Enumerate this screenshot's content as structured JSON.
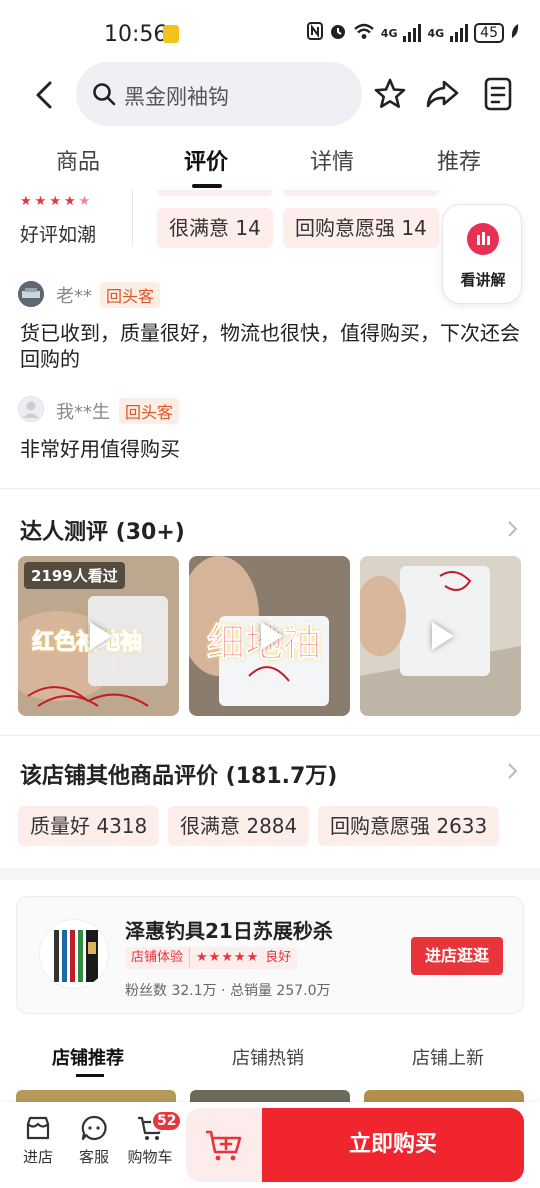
{
  "status_bar": {
    "time": "10:56",
    "network_1": "4G",
    "network_2": "4G",
    "wifi_label": "6",
    "battery": "45"
  },
  "search": {
    "query": "黑金刚袖钩"
  },
  "tabs": [
    {
      "label": "商品"
    },
    {
      "label": "评价",
      "active": true
    },
    {
      "label": "详情"
    },
    {
      "label": "推荐"
    }
  ],
  "rating": {
    "stars": 4.5,
    "label": "好评如潮",
    "chips": [
      {
        "label": "很满意 14"
      },
      {
        "label": "回购意愿强 14"
      }
    ],
    "explain_button": "看讲解"
  },
  "reviews": [
    {
      "name": "老**",
      "tag": "回头客",
      "text": "货已收到，质量很好，物流也很快，值得购买，下次还会回购的"
    },
    {
      "name": "我**生",
      "tag": "回头客",
      "text": "非常好用值得购买"
    }
  ],
  "influencer": {
    "title": "达人测评 (30+)",
    "videos": [
      {
        "views": "2199人看过",
        "overlay_text": "红色袖地袖"
      },
      {
        "overlay_text": "细地袖"
      },
      {
        "overlay_text": ""
      }
    ]
  },
  "store_reviews": {
    "title": "该店铺其他商品评价 (181.7万)",
    "chips": [
      {
        "label": "质量好 4318"
      },
      {
        "label": "很满意 2884"
      },
      {
        "label": "回购意愿强 2633"
      }
    ]
  },
  "store": {
    "name": "泽惠钓具21日苏展秒杀",
    "badge_experience": "店铺体验",
    "badge_stars": "★★★★★",
    "badge_rating": "良好",
    "stats": "粉丝数 32.1万 · 总销量 257.0万",
    "visit_button": "进店逛逛",
    "tabs": [
      {
        "label": "店铺推荐",
        "active": true
      },
      {
        "label": "店铺热销"
      },
      {
        "label": "店铺上新"
      }
    ]
  },
  "bottom_bar": {
    "shop": "进店",
    "service": "客服",
    "cart": "购物车",
    "cart_count": "52",
    "buy_now": "立即购买"
  },
  "colors": {
    "accent": "#f0252e",
    "chip_bg": "#fdeeec",
    "tag_orange": "#d9582b"
  }
}
